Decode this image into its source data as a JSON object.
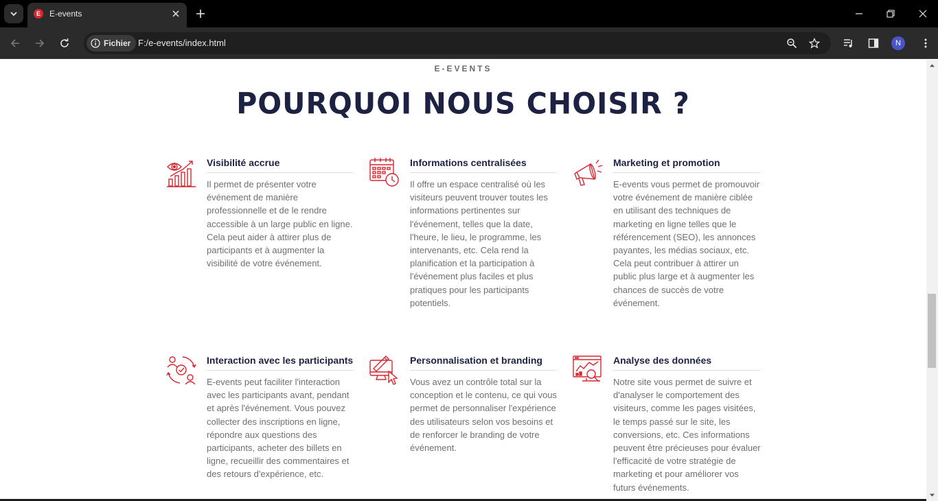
{
  "browser": {
    "tab_title": "E-events",
    "tab_favicon_letter": "E",
    "site_chip_label": "Fichier",
    "url": "F:/e-events/index.html",
    "avatar_letter": "N",
    "accent_color": "#d8262f"
  },
  "section": {
    "eyebrow": "E-EVENTS",
    "heading": "POURQUOI NOUS CHOISIR ?"
  },
  "features": [
    {
      "icon": "visibility-chart-icon",
      "title": "Visibilité accrue",
      "text": "Il permet de présenter votre événement de manière professionnelle et de le rendre accessible à un large public en ligne. Cela peut aider à attirer plus de participants et à augmenter la visibilité de votre événement."
    },
    {
      "icon": "calendar-clock-icon",
      "title": "Informations centralisées",
      "text": "Il offre un espace centralisé où les visiteurs peuvent trouver toutes les informations pertinentes sur l'événement, telles que la date, l'heure, le lieu, le programme, les intervenants, etc. Cela rend la planification et la participation à l'événement plus faciles et plus pratiques pour les participants potentiels."
    },
    {
      "icon": "megaphone-icon",
      "title": "Marketing et promotion",
      "text": "E-events vous permet de promouvoir votre événement de manière ciblée en utilisant des techniques de marketing en ligne telles que le référencement (SEO), les annonces payantes, les médias sociaux, etc. Cela peut contribuer à attirer un public plus large et à augmenter les chances de succès de votre événement."
    },
    {
      "icon": "users-interaction-icon",
      "title": "Interaction avec les participants",
      "text": "E-events peut faciliter l'interaction avec les participants avant, pendant et après l'événement. Vous pouvez collecter des inscriptions en ligne, répondre aux questions des participants, acheter des billets en ligne, recueillir des commentaires et des retours d'expérience, etc."
    },
    {
      "icon": "design-branding-icon",
      "title": "Personnalisation et branding",
      "text": "Vous avez un contrôle total sur la conception et le contenu, ce qui vous permet de personnaliser l'expérience des utilisateurs selon vos besoins et de renforcer le branding de votre événement."
    },
    {
      "icon": "data-analysis-icon",
      "title": "Analyse des données",
      "text": "Notre site vous permet de suivre et d'analyser le comportement des visiteurs, comme les pages visitées, le temps passé sur le site, les conversions, etc. Ces informations peuvent être précieuses pour évaluer l'efficacité de votre stratégie de marketing et pour améliorer vos futurs événements."
    }
  ]
}
